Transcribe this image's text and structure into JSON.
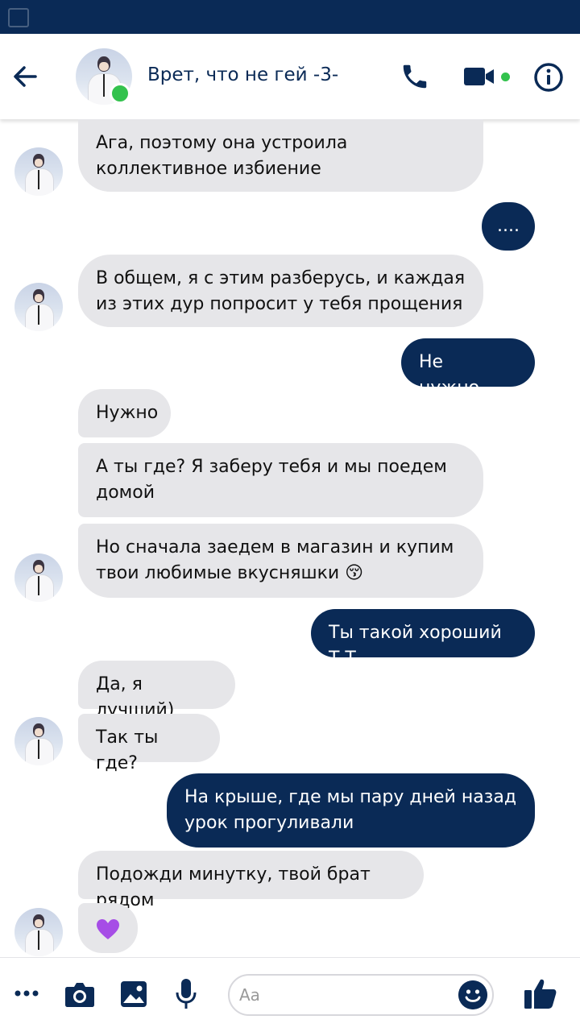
{
  "contact": {
    "name": "Врет, что не гей -3-"
  },
  "colors": {
    "accent": "#0a2a56",
    "online": "#33c24d",
    "incoming_bubble": "#e6e6e9"
  },
  "header_icons": [
    "arrow-left-icon",
    "phone-icon",
    "video-icon",
    "info-icon"
  ],
  "messages": [
    {
      "dir": "in",
      "text": "Ага, поэтому она устроила коллективное избиение"
    },
    {
      "dir": "out",
      "text": "...."
    },
    {
      "dir": "in",
      "text": "В общем, я с этим разберусь, и каждая из этих дур попросит у тебя прощения"
    },
    {
      "dir": "out",
      "text": "Не нужно..."
    },
    {
      "dir": "in",
      "text": "Нужно"
    },
    {
      "dir": "in",
      "text": "А ты где? Я заберу тебя и мы поедем домой"
    },
    {
      "dir": "in",
      "text": "Но сначала заедем в магазин и купим твои любимые вкусняшки 😚"
    },
    {
      "dir": "out",
      "text": "Ты такой хороший Т.Т"
    },
    {
      "dir": "in",
      "text": "Да, я лучший)"
    },
    {
      "dir": "in",
      "text": "Так ты где?"
    },
    {
      "dir": "out",
      "text": "На крыше, где мы пару дней назад урок прогуливали"
    },
    {
      "dir": "in",
      "text": "Подожди минутку, твой брат рядом"
    },
    {
      "dir": "in",
      "text": "💜",
      "kind": "heart-emoji"
    }
  ],
  "composer": {
    "placeholder": "Aa"
  },
  "bottom_icons": [
    "more-icon",
    "camera-icon",
    "image-icon",
    "microphone-icon",
    "emoji-icon",
    "thumbs-up-icon"
  ]
}
